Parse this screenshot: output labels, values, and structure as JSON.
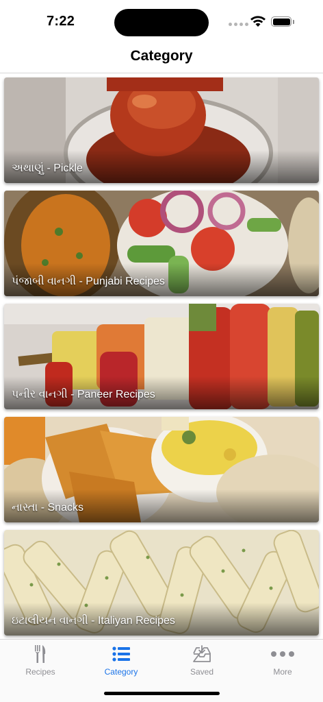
{
  "status": {
    "time": "7:22"
  },
  "nav": {
    "title": "Category"
  },
  "categories": [
    {
      "label": "અથાણું - Pickle",
      "image": "pickle-jar-photo"
    },
    {
      "label": "પંજાબી વાનગી - Punjabi Recipes",
      "image": "punjabi-thali-salad-photo"
    },
    {
      "label": "પનીર વાનગી - Paneer Recipes",
      "image": "paneer-tikka-skewer-photo"
    },
    {
      "label": "નાસ્તા - Snacks",
      "image": "snacks-platter-photo"
    },
    {
      "label": "ઇટાલીયન વાનગી - Italiyan Recipes",
      "image": "penne-pasta-photo"
    }
  ],
  "tabs": [
    {
      "label": "Recipes",
      "icon": "fork-knife-icon",
      "active": false
    },
    {
      "label": "Category",
      "icon": "list-icon",
      "active": true
    },
    {
      "label": "Saved",
      "icon": "tray-icon",
      "active": false
    },
    {
      "label": "More",
      "icon": "ellipsis-icon",
      "active": false
    }
  ],
  "colors": {
    "accent": "#1a73e8",
    "inactive": "#8e8e93"
  }
}
